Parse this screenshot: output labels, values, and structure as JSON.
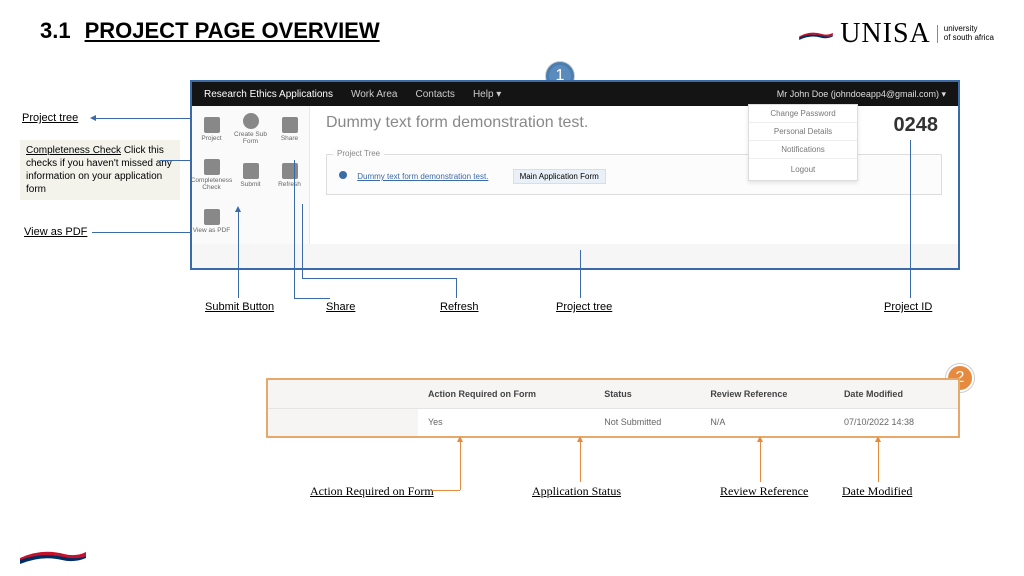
{
  "header": {
    "num": "3.1",
    "title": "PROJECT PAGE OVERVIEW"
  },
  "logo": {
    "text": "UNISA",
    "sub1": "university",
    "sub2": "of south africa"
  },
  "callouts": {
    "one": "1",
    "two": "2"
  },
  "sidebar_labels": {
    "project_tree": "Project tree",
    "completeness_title": "Completeness Check",
    "completeness_body": "Click this checks if you haven't missed any information on your application form",
    "view_pdf": "View as PDF"
  },
  "bottom_labels_1": {
    "submit": "Submit Button",
    "share": "Share",
    "refresh": "Refresh",
    "project_tree": "Project tree",
    "project_id": "Project ID"
  },
  "black_bar": {
    "app_name": "Research Ethics Applications",
    "menu1": "Work Area",
    "menu2": "Contacts",
    "menu3": "Help ▾",
    "user": "Mr John Doe (johndoeapp4@gmail.com) ▾"
  },
  "tools": {
    "project": "Project",
    "create_sub": "Create Sub Form",
    "share": "Share",
    "completeness": "Completeness Check",
    "submit": "Submit",
    "refresh": "Refresh",
    "view_pdf": "View as PDF"
  },
  "main": {
    "title": "Dummy text form demonstration test.",
    "id": "0248",
    "tree_legend": "Project Tree",
    "tree_item": "Dummy text form demonstration test.",
    "tree_sub": "Main Application Form"
  },
  "user_menu": {
    "change_pwd": "Change Password",
    "personal": "Personal Details",
    "notif": "Notifications",
    "logout": "Logout"
  },
  "table": {
    "h_blank": "",
    "h_action": "Action Required on Form",
    "h_status": "Status",
    "h_review": "Review Reference",
    "h_date": "Date Modified",
    "r_action": "Yes",
    "r_status": "Not Submitted",
    "r_review": "N/A",
    "r_date": "07/10/2022 14:38"
  },
  "bottom_labels_2": {
    "action": "Action Required on Form",
    "status": "Application Status",
    "review": "Review Reference",
    "date": "Date Modified"
  }
}
